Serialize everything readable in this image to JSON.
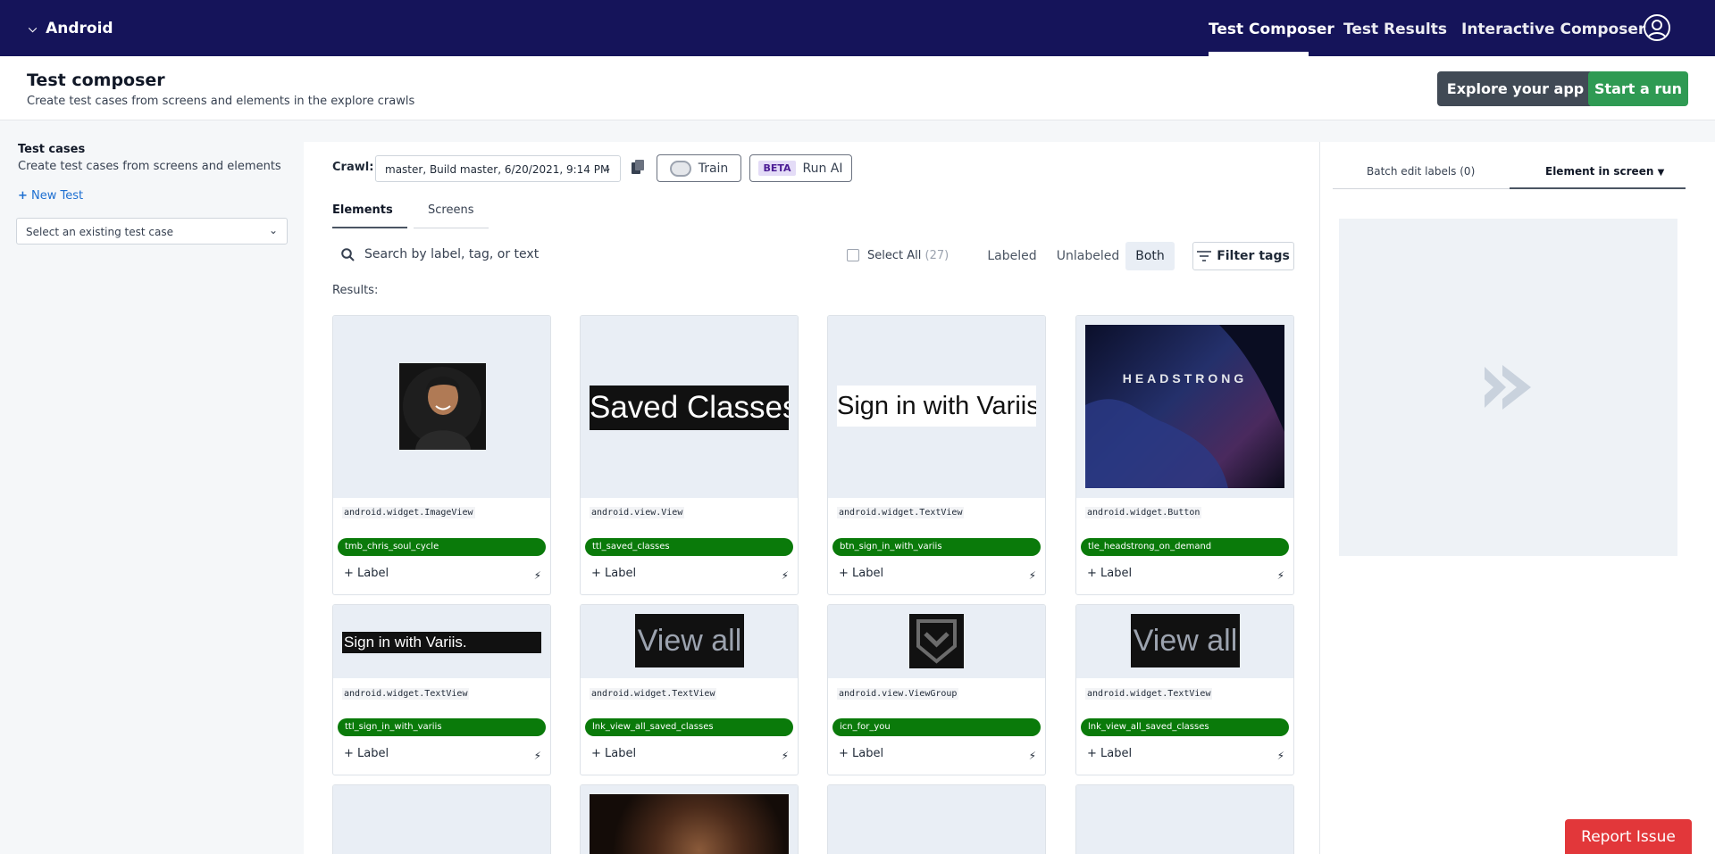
{
  "topnav": {
    "app_name": "Android",
    "tabs": [
      {
        "label": "Test Composer",
        "active": true
      },
      {
        "label": "Test Results",
        "active": false
      },
      {
        "label": "Interactive Composer",
        "active": false
      }
    ]
  },
  "header": {
    "title": "Test composer",
    "subtitle": "Create test cases from screens and elements in the explore crawls",
    "explore_button": "Explore your app",
    "run_button": "Start a run"
  },
  "left": {
    "title": "Test cases",
    "subtitle": "Create test cases from screens and elements",
    "new_test": "New Test",
    "select_placeholder": "Select an existing test case"
  },
  "main": {
    "crawl_label": "Crawl:",
    "crawl_value": "master, Build master, 6/20/2021, 9:14 PM",
    "train_label": "Train",
    "beta_badge": "BETA",
    "run_ai_label": "Run AI",
    "tabs": [
      {
        "label": "Elements",
        "active": true
      },
      {
        "label": "Screens",
        "active": false
      }
    ],
    "search_placeholder": "Search by label, tag, or text",
    "select_all": "Select All",
    "select_all_count": "(27)",
    "segments": [
      {
        "label": "Labeled"
      },
      {
        "label": "Unlabeled"
      },
      {
        "label": "Both",
        "active": true
      }
    ],
    "filter_label": "Filter tags",
    "results_label": "Results:",
    "add_label": "+ Label",
    "cards": [
      {
        "class": "android.widget.ImageView",
        "tag": "tmb_chris_soul_cycle",
        "thumb": "portrait"
      },
      {
        "class": "android.view.View",
        "tag": "ttl_saved_classes",
        "thumb": "text-dark",
        "thumb_text": "Saved Classes"
      },
      {
        "class": "android.widget.TextView",
        "tag": "btn_sign_in_with_variis",
        "thumb": "text-light",
        "thumb_text": "Sign in with Variis"
      },
      {
        "class": "android.widget.Button",
        "tag": "tle_headstrong_on_demand",
        "thumb": "headstrong",
        "thumb_text": "HEADSTRONG"
      },
      {
        "class": "android.widget.TextView",
        "tag": "ttl_sign_in_with_variis",
        "thumb": "text-dark-small",
        "thumb_text": "Sign in with Variis."
      },
      {
        "class": "android.widget.TextView",
        "tag": "lnk_view_all_saved_classes",
        "thumb": "viewall",
        "thumb_text": "View all"
      },
      {
        "class": "android.view.ViewGroup",
        "tag": "icn_for_you",
        "thumb": "icon"
      },
      {
        "class": "android.widget.TextView",
        "tag": "lnk_view_all_saved_classes",
        "thumb": "viewall",
        "thumb_text": "View all"
      }
    ]
  },
  "right": {
    "tab1": "Batch edit labels (0)",
    "tab2": "Element in screen"
  },
  "report_issue": "Report Issue",
  "colors": {
    "nav_bg": "#15145a",
    "tag_green": "#0a7a0a",
    "run_green": "#2f9a53",
    "report_red": "#e2373a"
  }
}
